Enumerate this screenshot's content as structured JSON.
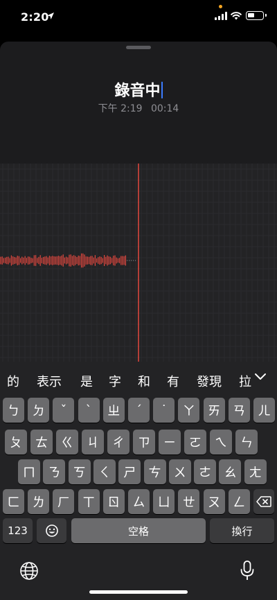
{
  "status_bar": {
    "time": "2:20"
  },
  "recording": {
    "title": "錄音中",
    "date": "下午 2:19",
    "elapsed": "00:14",
    "accent_color": "#e5483f"
  },
  "keyboard": {
    "candidates": [
      "的",
      "表示",
      "是",
      "字",
      "和",
      "有",
      "發現",
      "拉"
    ],
    "row1": [
      "ㄅ",
      "ㄉ",
      "ˇ",
      "ˋ",
      "ㄓ",
      "ˊ",
      "˙",
      "ㄚ",
      "ㄞ",
      "ㄢ",
      "ㄦ"
    ],
    "row2": [
      "ㄆ",
      "ㄊ",
      "ㄍ",
      "ㄐ",
      "ㄔ",
      "ㄗ",
      "ㄧ",
      "ㄛ",
      "ㄟ",
      "ㄣ"
    ],
    "row3": [
      "ㄇ",
      "ㄋ",
      "ㄎ",
      "ㄑ",
      "ㄕ",
      "ㄘ",
      "ㄨ",
      "ㄜ",
      "ㄠ",
      "ㄤ"
    ],
    "row4": [
      "ㄈ",
      "ㄌ",
      "ㄏ",
      "ㄒ",
      "ㄖ",
      "ㄙ",
      "ㄩ",
      "ㄝ",
      "ㄡ",
      "ㄥ"
    ],
    "numbers_label": "123",
    "space_label": "空格",
    "return_label": "換行",
    "icons": {
      "emoji": "emoji-icon",
      "delete": "delete-icon",
      "globe": "globe-icon",
      "mic": "microphone-icon",
      "collapse": "chevron-down-icon"
    }
  }
}
